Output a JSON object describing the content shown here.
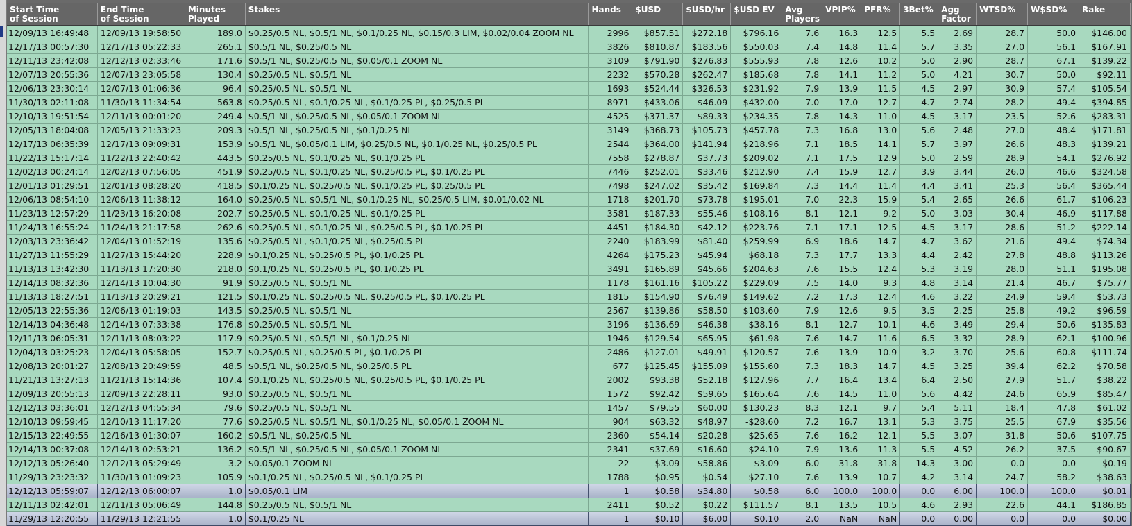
{
  "columns": [
    {
      "key": "start",
      "label": "Start Time\nof Session",
      "w": 131,
      "align": "left"
    },
    {
      "key": "end",
      "label": "End Time\nof Session",
      "w": 126,
      "align": "left"
    },
    {
      "key": "minutes",
      "label": "Minutes\nPlayed",
      "w": 87,
      "align": "right"
    },
    {
      "key": "stakes",
      "label": "Stakes",
      "w": 495,
      "align": "left"
    },
    {
      "key": "hands",
      "label": "Hands",
      "w": 63,
      "align": "right"
    },
    {
      "key": "usd",
      "label": "$USD",
      "w": 73,
      "align": "right"
    },
    {
      "key": "usd_hr",
      "label": "$USD/hr",
      "w": 69,
      "align": "right"
    },
    {
      "key": "usd_ev",
      "label": "$USD EV",
      "w": 74,
      "align": "right"
    },
    {
      "key": "avg_players",
      "label": "Avg\nPlayers",
      "w": 58,
      "align": "right"
    },
    {
      "key": "vpip",
      "label": "VPIP%",
      "w": 56,
      "align": "right"
    },
    {
      "key": "pfr",
      "label": "PFR%",
      "w": 56,
      "align": "right"
    },
    {
      "key": "threebet",
      "label": "3Bet%",
      "w": 55,
      "align": "right"
    },
    {
      "key": "agg",
      "label": "Agg\nFactor",
      "w": 55,
      "align": "right"
    },
    {
      "key": "wtsd",
      "label": "WTSD%",
      "w": 74,
      "align": "right"
    },
    {
      "key": "wsd",
      "label": "W$SD%",
      "w": 74,
      "align": "right"
    },
    {
      "key": "rake",
      "label": "Rake",
      "w": 74,
      "align": "right"
    }
  ],
  "rows": [
    [
      "12/09/13 16:49:48",
      "12/09/13 19:58:50",
      "189.0",
      "$0.25/0.5 NL, $0.5/1 NL, $0.1/0.25 NL, $0.15/0.3 LIM, $0.02/0.04 ZOOM NL",
      "2996",
      "$857.51",
      "$272.18",
      "$796.16",
      "7.6",
      "16.3",
      "12.5",
      "5.5",
      "2.69",
      "28.7",
      "50.0",
      "$146.00"
    ],
    [
      "12/17/13 00:57:30",
      "12/17/13 05:22:33",
      "265.1",
      "$0.5/1 NL, $0.25/0.5 NL",
      "3826",
      "$810.87",
      "$183.56",
      "$550.03",
      "7.4",
      "14.8",
      "11.4",
      "5.7",
      "3.35",
      "27.0",
      "56.1",
      "$167.91"
    ],
    [
      "12/11/13 23:42:08",
      "12/12/13 02:33:46",
      "171.6",
      "$0.5/1 NL, $0.25/0.5 NL, $0.05/0.1 ZOOM NL",
      "3109",
      "$791.90",
      "$276.83",
      "$555.93",
      "7.8",
      "12.6",
      "10.2",
      "5.0",
      "2.90",
      "28.7",
      "67.1",
      "$139.22"
    ],
    [
      "12/07/13 20:55:36",
      "12/07/13 23:05:58",
      "130.4",
      "$0.25/0.5 NL, $0.5/1 NL",
      "2232",
      "$570.28",
      "$262.47",
      "$185.68",
      "7.8",
      "14.1",
      "11.2",
      "5.0",
      "4.21",
      "30.7",
      "50.0",
      "$92.11"
    ],
    [
      "12/06/13 23:30:14",
      "12/07/13 01:06:36",
      "96.4",
      "$0.25/0.5 NL, $0.5/1 NL",
      "1693",
      "$524.44",
      "$326.53",
      "$231.92",
      "7.9",
      "13.9",
      "11.5",
      "4.5",
      "2.97",
      "30.9",
      "57.4",
      "$105.54"
    ],
    [
      "11/30/13 02:11:08",
      "11/30/13 11:34:54",
      "563.8",
      "$0.25/0.5 NL, $0.1/0.25 NL, $0.1/0.25 PL, $0.25/0.5 PL",
      "8971",
      "$433.06",
      "$46.09",
      "$432.00",
      "7.0",
      "17.0",
      "12.7",
      "4.7",
      "2.74",
      "28.2",
      "49.4",
      "$394.85"
    ],
    [
      "12/10/13 19:51:54",
      "12/11/13 00:01:20",
      "249.4",
      "$0.5/1 NL, $0.25/0.5 NL, $0.05/0.1 ZOOM NL",
      "4525",
      "$371.37",
      "$89.33",
      "$234.35",
      "7.8",
      "14.3",
      "11.0",
      "4.5",
      "3.17",
      "23.5",
      "52.6",
      "$283.31"
    ],
    [
      "12/05/13 18:04:08",
      "12/05/13 21:33:23",
      "209.3",
      "$0.5/1 NL, $0.25/0.5 NL, $0.1/0.25 NL",
      "3149",
      "$368.73",
      "$105.73",
      "$457.78",
      "7.3",
      "16.8",
      "13.0",
      "5.6",
      "2.48",
      "27.0",
      "48.4",
      "$171.81"
    ],
    [
      "12/17/13 06:35:39",
      "12/17/13 09:09:31",
      "153.9",
      "$0.5/1 NL, $0.05/0.1 LIM, $0.25/0.5 NL, $0.1/0.25 NL, $0.25/0.5 PL",
      "2544",
      "$364.00",
      "$141.94",
      "$218.96",
      "7.1",
      "18.5",
      "14.1",
      "5.7",
      "3.97",
      "26.6",
      "48.3",
      "$139.21"
    ],
    [
      "11/22/13 15:17:14",
      "11/22/13 22:40:42",
      "443.5",
      "$0.25/0.5 NL, $0.1/0.25 NL, $0.1/0.25 PL",
      "7558",
      "$278.87",
      "$37.73",
      "$209.02",
      "7.1",
      "17.5",
      "12.9",
      "5.0",
      "2.59",
      "28.9",
      "54.1",
      "$276.92"
    ],
    [
      "12/02/13 00:24:14",
      "12/02/13 07:56:05",
      "451.9",
      "$0.25/0.5 NL, $0.1/0.25 NL, $0.25/0.5 PL, $0.1/0.25 PL",
      "7446",
      "$252.01",
      "$33.46",
      "$212.90",
      "7.4",
      "15.9",
      "12.7",
      "3.9",
      "3.44",
      "26.0",
      "46.6",
      "$324.58"
    ],
    [
      "12/01/13 01:29:51",
      "12/01/13 08:28:20",
      "418.5",
      "$0.1/0.25 NL, $0.25/0.5 NL, $0.1/0.25 PL, $0.25/0.5 PL",
      "7498",
      "$247.02",
      "$35.42",
      "$169.84",
      "7.3",
      "14.4",
      "11.4",
      "4.4",
      "3.41",
      "25.3",
      "56.4",
      "$365.44"
    ],
    [
      "12/06/13 08:54:10",
      "12/06/13 11:38:12",
      "164.0",
      "$0.25/0.5 NL, $0.5/1 NL, $0.1/0.25 NL, $0.25/0.5 LIM, $0.01/0.02 NL",
      "1718",
      "$201.70",
      "$73.78",
      "$195.01",
      "7.0",
      "22.3",
      "15.9",
      "5.4",
      "2.65",
      "26.6",
      "61.7",
      "$106.23"
    ],
    [
      "11/23/13 12:57:29",
      "11/23/13 16:20:08",
      "202.7",
      "$0.25/0.5 NL, $0.1/0.25 NL, $0.1/0.25 PL",
      "3581",
      "$187.33",
      "$55.46",
      "$108.16",
      "8.1",
      "12.1",
      "9.2",
      "5.0",
      "3.03",
      "30.4",
      "46.9",
      "$117.88"
    ],
    [
      "11/24/13 16:55:24",
      "11/24/13 21:17:58",
      "262.6",
      "$0.25/0.5 NL, $0.1/0.25 NL, $0.25/0.5 PL, $0.1/0.25 PL",
      "4451",
      "$184.30",
      "$42.12",
      "$223.76",
      "7.1",
      "17.1",
      "12.5",
      "4.5",
      "3.17",
      "28.6",
      "51.2",
      "$222.14"
    ],
    [
      "12/03/13 23:36:42",
      "12/04/13 01:52:19",
      "135.6",
      "$0.25/0.5 NL, $0.1/0.25 NL, $0.25/0.5 PL",
      "2240",
      "$183.99",
      "$81.40",
      "$259.99",
      "6.9",
      "18.6",
      "14.7",
      "4.7",
      "3.62",
      "21.6",
      "49.4",
      "$74.34"
    ],
    [
      "11/27/13 11:55:29",
      "11/27/13 15:44:20",
      "228.9",
      "$0.1/0.25 NL, $0.25/0.5 PL, $0.1/0.25 PL",
      "4264",
      "$175.23",
      "$45.94",
      "$68.18",
      "7.3",
      "17.7",
      "13.3",
      "4.4",
      "2.42",
      "27.8",
      "48.8",
      "$113.26"
    ],
    [
      "11/13/13 13:42:30",
      "11/13/13 17:20:30",
      "218.0",
      "$0.1/0.25 NL, $0.25/0.5 PL, $0.1/0.25 PL",
      "3491",
      "$165.89",
      "$45.66",
      "$204.63",
      "7.6",
      "15.5",
      "12.4",
      "5.3",
      "3.19",
      "28.0",
      "51.1",
      "$195.08"
    ],
    [
      "12/14/13 08:32:36",
      "12/14/13 10:04:30",
      "91.9",
      "$0.25/0.5 NL, $0.5/1 NL",
      "1178",
      "$161.16",
      "$105.22",
      "$229.09",
      "7.5",
      "14.0",
      "9.3",
      "4.8",
      "3.14",
      "21.4",
      "46.7",
      "$75.77"
    ],
    [
      "11/13/13 18:27:51",
      "11/13/13 20:29:21",
      "121.5",
      "$0.1/0.25 NL, $0.25/0.5 NL, $0.25/0.5 PL, $0.1/0.25 PL",
      "1815",
      "$154.90",
      "$76.49",
      "$149.62",
      "7.2",
      "17.3",
      "12.4",
      "4.6",
      "3.22",
      "24.9",
      "59.4",
      "$53.73"
    ],
    [
      "12/05/13 22:55:36",
      "12/06/13 01:19:03",
      "143.5",
      "$0.25/0.5 NL, $0.5/1 NL",
      "2567",
      "$139.86",
      "$58.50",
      "$103.60",
      "7.9",
      "12.6",
      "9.5",
      "3.5",
      "2.25",
      "25.8",
      "49.2",
      "$96.59"
    ],
    [
      "12/14/13 04:36:48",
      "12/14/13 07:33:38",
      "176.8",
      "$0.25/0.5 NL, $0.5/1 NL",
      "3196",
      "$136.69",
      "$46.38",
      "$38.16",
      "8.1",
      "12.7",
      "10.1",
      "4.6",
      "3.49",
      "29.4",
      "50.6",
      "$135.83"
    ],
    [
      "12/11/13 06:05:31",
      "12/11/13 08:03:22",
      "117.9",
      "$0.25/0.5 NL, $0.5/1 NL, $0.1/0.25 NL",
      "1946",
      "$129.54",
      "$65.95",
      "$61.98",
      "7.6",
      "14.7",
      "11.6",
      "6.5",
      "3.32",
      "28.9",
      "62.1",
      "$100.96"
    ],
    [
      "12/04/13 03:25:23",
      "12/04/13 05:58:05",
      "152.7",
      "$0.25/0.5 NL, $0.25/0.5 PL, $0.1/0.25 PL",
      "2486",
      "$127.01",
      "$49.91",
      "$120.57",
      "7.6",
      "13.9",
      "10.9",
      "3.2",
      "3.70",
      "25.6",
      "60.8",
      "$111.74"
    ],
    [
      "12/08/13 20:01:27",
      "12/08/13 20:49:59",
      "48.5",
      "$0.5/1 NL, $0.25/0.5 NL, $0.25/0.5 PL",
      "677",
      "$125.45",
      "$155.09",
      "$155.60",
      "7.3",
      "18.3",
      "14.7",
      "4.5",
      "3.25",
      "39.4",
      "62.2",
      "$70.58"
    ],
    [
      "11/21/13 13:27:13",
      "11/21/13 15:14:36",
      "107.4",
      "$0.1/0.25 NL, $0.25/0.5 NL, $0.25/0.5 PL, $0.1/0.25 PL",
      "2002",
      "$93.38",
      "$52.18",
      "$127.96",
      "7.7",
      "16.4",
      "13.4",
      "6.4",
      "2.50",
      "27.9",
      "51.7",
      "$38.22"
    ],
    [
      "12/09/13 20:55:13",
      "12/09/13 22:28:11",
      "93.0",
      "$0.25/0.5 NL, $0.5/1 NL",
      "1572",
      "$92.42",
      "$59.65",
      "$165.64",
      "7.6",
      "14.5",
      "11.0",
      "5.6",
      "4.42",
      "24.6",
      "65.9",
      "$85.47"
    ],
    [
      "12/12/13 03:36:01",
      "12/12/13 04:55:34",
      "79.6",
      "$0.25/0.5 NL, $0.5/1 NL",
      "1457",
      "$79.55",
      "$60.00",
      "$130.23",
      "8.3",
      "12.1",
      "9.7",
      "5.4",
      "5.11",
      "18.4",
      "47.8",
      "$61.02"
    ],
    [
      "12/10/13 09:59:45",
      "12/10/13 11:17:20",
      "77.6",
      "$0.25/0.5 NL, $0.5/1 NL, $0.1/0.25 NL, $0.05/0.1 ZOOM NL",
      "904",
      "$63.32",
      "$48.97",
      "-$28.60",
      "7.2",
      "16.7",
      "13.1",
      "5.3",
      "3.75",
      "25.5",
      "67.9",
      "$35.56"
    ],
    [
      "12/15/13 22:49:55",
      "12/16/13 01:30:07",
      "160.2",
      "$0.5/1 NL, $0.25/0.5 NL",
      "2360",
      "$54.14",
      "$20.28",
      "-$25.65",
      "7.6",
      "16.2",
      "12.1",
      "5.5",
      "3.07",
      "31.8",
      "50.6",
      "$107.75"
    ],
    [
      "12/14/13 00:37:08",
      "12/14/13 02:53:21",
      "136.2",
      "$0.5/1 NL, $0.25/0.5 NL, $0.05/0.1 ZOOM NL",
      "2341",
      "$37.69",
      "$16.60",
      "-$24.10",
      "7.9",
      "13.6",
      "11.3",
      "5.5",
      "4.52",
      "26.2",
      "37.5",
      "$90.67"
    ],
    [
      "12/12/13 05:26:40",
      "12/12/13 05:29:49",
      "3.2",
      "$0.05/0.1 ZOOM NL",
      "22",
      "$3.09",
      "$58.86",
      "$3.09",
      "6.0",
      "31.8",
      "31.8",
      "14.3",
      "3.00",
      "0.0",
      "0.0",
      "$0.19"
    ],
    [
      "11/29/13 23:23:32",
      "11/30/13 01:09:23",
      "105.9",
      "$0.1/0.25 NL, $0.25/0.5 NL, $0.1/0.25 PL",
      "1788",
      "$0.95",
      "$0.54",
      "$27.10",
      "7.6",
      "13.9",
      "10.7",
      "4.2",
      "3.14",
      "24.7",
      "58.2",
      "$38.63"
    ],
    [
      "12/12/13 05:59:07",
      "12/12/13 06:00:07",
      "1.0",
      "$0.05/0.1 LIM",
      "1",
      "$0.58",
      "$34.80",
      "$0.58",
      "6.0",
      "100.0",
      "100.0",
      "0.0",
      "6.00",
      "100.0",
      "100.0",
      "$0.01"
    ],
    [
      "12/11/13 02:42:01",
      "12/11/13 05:06:49",
      "144.8",
      "$0.25/0.5 NL, $0.5/1 NL",
      "2411",
      "$0.52",
      "$0.22",
      "$111.57",
      "8.1",
      "13.5",
      "10.5",
      "4.6",
      "2.93",
      "22.6",
      "44.1",
      "$186.85"
    ],
    [
      "11/29/13 12:20:55",
      "11/29/13 12:21:55",
      "1.0",
      "$0.1/0.25 NL",
      "1",
      "$0.10",
      "$6.00",
      "$0.10",
      "2.0",
      "NaN",
      "NaN",
      "0.0",
      "0.00",
      "0.0",
      "0.0",
      "$0.00"
    ]
  ],
  "selected_rows": [
    33,
    35
  ],
  "colors": {
    "row_bg": "#a8d9bf",
    "header_bg": "#666666",
    "selected_bg": "#b9c2d6"
  }
}
